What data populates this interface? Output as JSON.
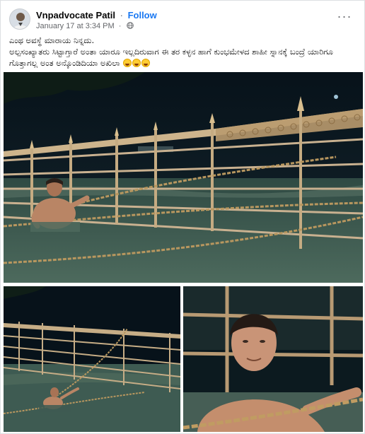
{
  "post": {
    "author": "Vnpadvocate Patil",
    "follow_label": "Follow",
    "separator": "·",
    "timestamp": "January 17 at 3:34 PM",
    "audience_icon": "globe-icon",
    "more_icon": "more-options-icon",
    "more_label": "···",
    "caption_line1": "ಎಂಥ ಅವಸ್ಥೆ ಮಾರಾಯ ನಿನ್ನದು.",
    "caption_line2": "ಅಲ್ಪಸಂಖ್ಯಾತರು ಸಿಟ್ಟಾಗ್ತಾರೆ ಅಂತಾ ಯಾರೂ ಇಲ್ಲದಿರುವಾಗ ಈ ತರ ಕಳ್ಳನ ಹಾಗೆ ಕುಂಭಮೇಳದ ಶಾಹೀ ಸ್ನಾನಕ್ಕೆ ಬಂದ್ರೆ ಯಾರಿಗೂ ಗೊತ್ತಾಗಲ್ಲ ಅಂತ ಅನ್ಕೊಂಡಿದಿಯಾ ಅಖಿಲಾ",
    "emoji_icons": [
      "rofl-emoji-icon",
      "rofl-emoji-icon",
      "rofl-emoji-icon"
    ]
  },
  "colors": {
    "follow": "#1877f2",
    "secondary_text": "#65676b",
    "water": "#3f5a4e",
    "railing": "#c7ad86",
    "chain": "#b89868",
    "night_sky": "#0b1620"
  }
}
